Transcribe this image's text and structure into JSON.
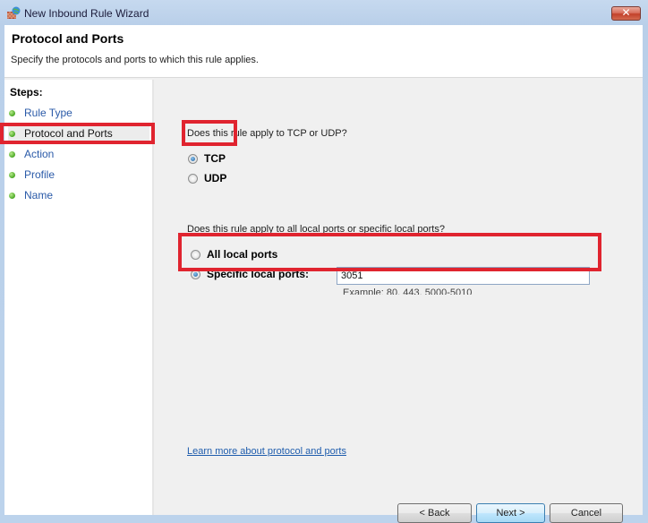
{
  "window": {
    "title": "New Inbound Rule Wizard",
    "app_icon": "firewall-globe-icon",
    "close_glyph": "✕"
  },
  "header": {
    "title": "Protocol and Ports",
    "subtitle": "Specify the protocols and ports to which this rule applies."
  },
  "sidebar": {
    "label": "Steps:",
    "items": [
      {
        "label": "Rule Type",
        "active": false
      },
      {
        "label": "Protocol and Ports",
        "active": true
      },
      {
        "label": "Action",
        "active": false
      },
      {
        "label": "Profile",
        "active": false
      },
      {
        "label": "Name",
        "active": false
      }
    ]
  },
  "protocol": {
    "question": "Does this rule apply to TCP or UDP?",
    "options": [
      {
        "label": "TCP",
        "selected": true
      },
      {
        "label": "UDP",
        "selected": false
      }
    ]
  },
  "ports": {
    "question": "Does this rule apply to all local ports or specific local ports?",
    "options": [
      {
        "label": "All local ports",
        "selected": false
      },
      {
        "label": "Specific local ports:",
        "selected": true
      }
    ],
    "value": "3051",
    "example": "Example: 80, 443, 5000-5010"
  },
  "link": "Learn more about protocol and ports",
  "buttons": {
    "back": "< Back",
    "next": "Next >",
    "cancel": "Cancel"
  },
  "highlight_color": "#e0242f"
}
